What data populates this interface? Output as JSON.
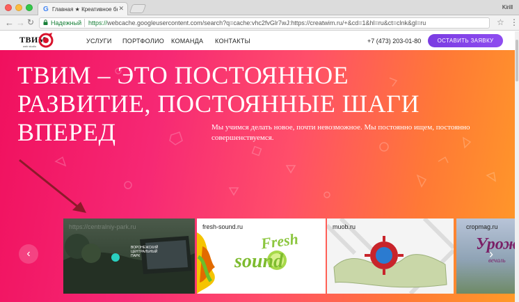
{
  "browser": {
    "tab_title": "Главная ★ Креативное бюро",
    "tab_favicon": "G",
    "user": "Kirill",
    "secure_label": "Надежный",
    "url_scheme": "https://",
    "url_rest": "webcache.googleusercontent.com/search?q=cache:vhc2fvGlr7wJ:https://creatwim.ru/+&cd=1&hl=ru&ct=clnk&gl=ru"
  },
  "site": {
    "logo": "ТВИМ",
    "logo_sub": "web studio",
    "nav": [
      "УСЛУГИ",
      "ПОРТФОЛИО",
      "КОМАНДА",
      "КОНТАКТЫ"
    ],
    "phone": "+7 (473) 203-01-80",
    "cta": "ОСТАВИТЬ ЗАЯВКУ"
  },
  "hero": {
    "title_lines": [
      "ТВИМ – ЭТО ПОСТОЯННОЕ",
      "РАЗВИТИЕ, ПОСТОЯННЫЕ ШАГИ",
      "ВПЕРЕД"
    ],
    "subtitle": "Мы учимся делать новое, почти невозможное. Мы постоянно ищем, постоянно совершенствуемся.",
    "gradient": [
      "#f0105e",
      "#ff9a28"
    ]
  },
  "portfolio": {
    "slides": [
      {
        "label": "https://centralniy-park.ru",
        "caption": "ВОРОНЕЖСКИЙ ЦЕНТРАЛЬНЫЙ ПАРК"
      },
      {
        "label": "fresh-sound.ru",
        "logo_top": "Fresh",
        "logo_bottom": "sound"
      },
      {
        "label": "muob.ru"
      },
      {
        "label": "cropmag.ru",
        "logo_top": "Урож",
        "logo_bottom": "вечаль"
      }
    ],
    "prev_icon": "chevron-left-icon",
    "next_icon": "chevron-right-icon"
  },
  "colors": {
    "accent_button": "#8e4cf0",
    "secure_green": "#188038",
    "annotation_arrow": "#8b1a2a"
  }
}
